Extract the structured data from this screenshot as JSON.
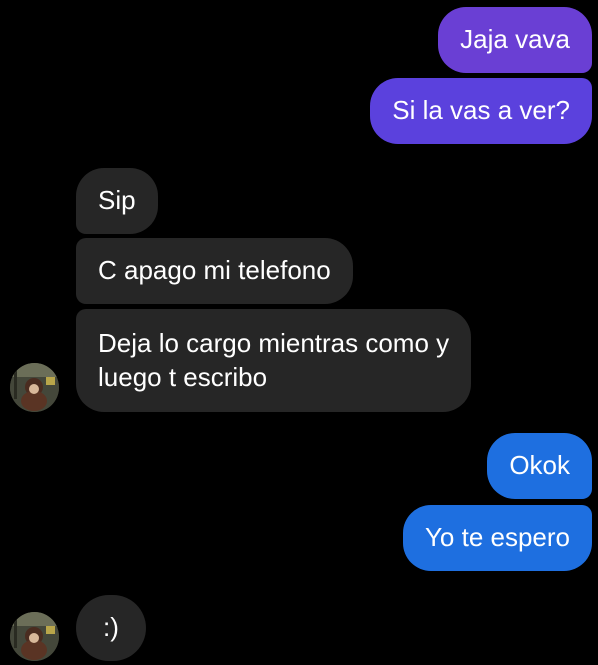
{
  "colors": {
    "background": "#000000",
    "sent_purple": "#6a3fd4",
    "sent_violet": "#5b41dd",
    "sent_blue": "#1e6fe0",
    "received": "#262626",
    "text": "#ffffff"
  },
  "messages": {
    "sent_1": "Jaja vava",
    "sent_2": "Si la vas a ver?",
    "received_1": "Sip",
    "received_2": "C apago mi telefono",
    "received_3_line1": "Deja lo cargo mientras como y",
    "received_3_line2": "luego t escribo",
    "sent_3": "Okok",
    "sent_4": "Yo te espero",
    "received_4": ":)"
  },
  "contact": {
    "avatar_icon": "contact-avatar-icon"
  }
}
